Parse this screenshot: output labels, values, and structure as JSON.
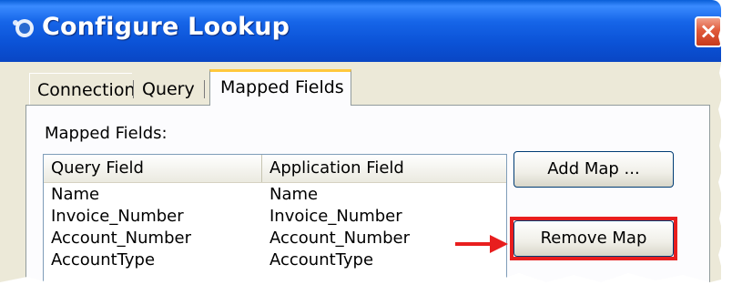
{
  "window": {
    "title": "Configure Lookup"
  },
  "tabs": [
    {
      "label": "Connection"
    },
    {
      "label": "Query"
    },
    {
      "label": "Mapped Fields"
    }
  ],
  "active_tab": "Mapped Fields",
  "mapped_fields": {
    "section_label": "Mapped Fields:",
    "columns": [
      "Query Field",
      "Application Field"
    ],
    "rows": [
      {
        "query_field": "Name",
        "application_field": "Name"
      },
      {
        "query_field": "Invoice_Number",
        "application_field": "Invoice_Number"
      },
      {
        "query_field": "Account_Number",
        "application_field": "Account_Number"
      },
      {
        "query_field": "AccountType",
        "application_field": "AccountType"
      }
    ]
  },
  "buttons": {
    "add_map": "Add Map ...",
    "remove_map": "Remove Map"
  },
  "annotation": {
    "highlight_color": "#e81e1e"
  },
  "icons": {
    "app": "app-logo-icon",
    "close": "close-icon",
    "arrow": "arrow-right-icon"
  }
}
